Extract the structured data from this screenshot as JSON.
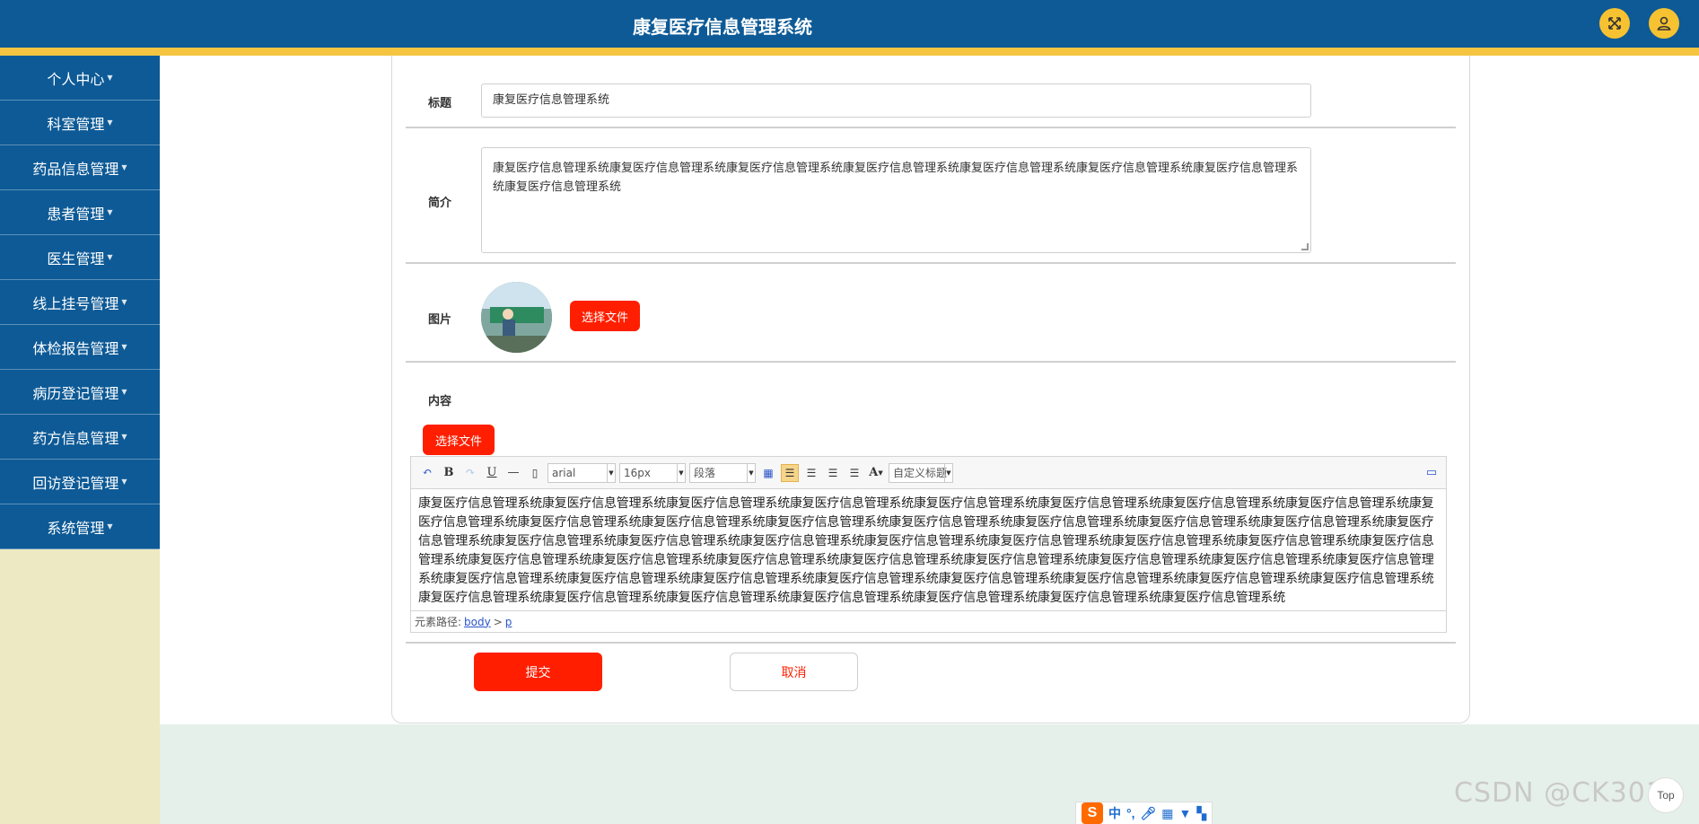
{
  "header": {
    "title": "康复医疗信息管理系统",
    "fullscreen_icon": "expand-icon",
    "user_icon": "user-icon"
  },
  "sidebar": {
    "items": [
      {
        "label": "个人中心"
      },
      {
        "label": "科室管理"
      },
      {
        "label": "药品信息管理"
      },
      {
        "label": "患者管理"
      },
      {
        "label": "医生管理"
      },
      {
        "label": "线上挂号管理"
      },
      {
        "label": "体检报告管理"
      },
      {
        "label": "病历登记管理"
      },
      {
        "label": "药方信息管理"
      },
      {
        "label": "回访登记管理"
      },
      {
        "label": "系统管理"
      }
    ]
  },
  "form": {
    "title_label": "标题",
    "title_value": "康复医疗信息管理系统",
    "intro_label": "简介",
    "intro_value": "康复医疗信息管理系统康复医疗信息管理系统康复医疗信息管理系统康复医疗信息管理系统康复医疗信息管理系统康复医疗信息管理系统康复医疗信息管理系统康复医疗信息管理系统",
    "image_label": "图片",
    "image_button": "选择文件",
    "content_label": "内容",
    "content_button": "选择文件",
    "submit_label": "提交",
    "cancel_label": "取消"
  },
  "editor": {
    "font_family": "arial",
    "font_size": "16px",
    "paragraph": "段落",
    "custom_title": "自定义标题",
    "content": "康复医疗信息管理系统康复医疗信息管理系统康复医疗信息管理系统康复医疗信息管理系统康复医疗信息管理系统康复医疗信息管理系统康复医疗信息管理系统康复医疗信息管理系统康复医疗信息管理系统康复医疗信息管理系统康复医疗信息管理系统康复医疗信息管理系统康复医疗信息管理系统康复医疗信息管理系统康复医疗信息管理系统康复医疗信息管理系统康复医疗信息管理系统康复医疗信息管理系统康复医疗信息管理系统康复医疗信息管理系统康复医疗信息管理系统康复医疗信息管理系统康复医疗信息管理系统康复医疗信息管理系统康复医疗信息管理系统康复医疗信息管理系统康复医疗信息管理系统康复医疗信息管理系统康复医疗信息管理系统康复医疗信息管理系统康复医疗信息管理系统康复医疗信息管理系统康复医疗信息管理系统康复医疗信息管理系统康复医疗信息管理系统康复医疗信息管理系统康复医疗信息管理系统康复医疗信息管理系统康复医疗信息管理系统康复医疗信息管理系统康复医疗信息管理系统康复医疗信息管理系统康复医疗信息管理系统康复医疗信息管理系统康复医疗信息管理系统康复医疗信息管理系统康复医疗信息管理系统康复医疗信息管理系统",
    "path_label": "元素路径:",
    "path_body": "body",
    "path_sep": ">",
    "path_p": "p"
  },
  "ime": {
    "logo": "S",
    "lang": "中"
  },
  "watermark": "CSDN @CK3011",
  "float_button": "Top"
}
